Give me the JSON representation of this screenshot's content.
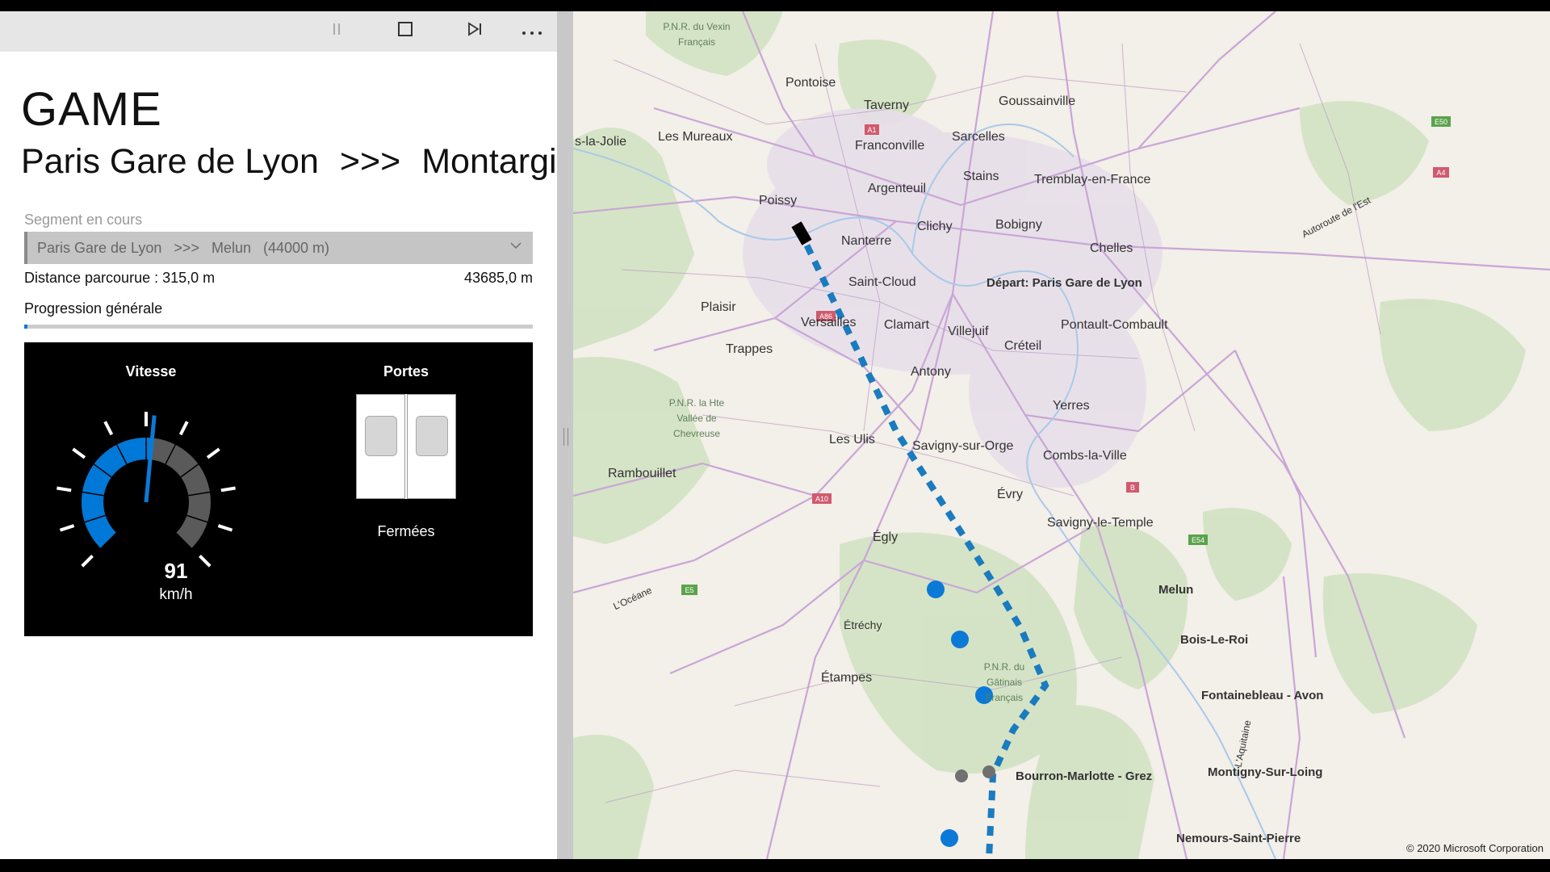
{
  "toolbar": {
    "pause_icon": "pause-icon",
    "stop_icon": "stop-icon",
    "skip_icon": "skip-next-icon",
    "more_icon": "more-icon"
  },
  "header": {
    "title": "GAME",
    "origin": "Paris Gare de Lyon",
    "separator": ">>>",
    "destination": "Montargis"
  },
  "segment": {
    "label": "Segment en cours",
    "selected": "Paris Gare de Lyon   >>>   Melun   (44000 m)"
  },
  "distance": {
    "traveled": "Distance parcourue : 315,0 m",
    "remaining": "43685,0 m"
  },
  "progress": {
    "label": "Progression générale",
    "fraction": 0.007
  },
  "speed": {
    "label": "Vitesse",
    "value": "91",
    "unit": "km/h",
    "gauge_fraction": 0.52
  },
  "doors": {
    "label": "Portes",
    "state": "Fermées"
  },
  "map": {
    "places": [
      "P.N.R. du Vexin Français",
      "Pontoise",
      "Taverny",
      "Goussainville",
      "Les Mureaux",
      "s-la-Jolie",
      "Sarcelles",
      "Franconville",
      "Stains",
      "Tremblay-en-France",
      "Argenteuil",
      "Poissy",
      "Clichy",
      "Bobigny",
      "Nanterre",
      "Chelles",
      "Saint-Cloud",
      "Plaisir",
      "Versailles",
      "Clamart",
      "Villejuif",
      "Créteil",
      "Pontault-Combault",
      "Trappes",
      "Antony",
      "P.N.R. la Hte Vallée de Chevreuse",
      "Yerres",
      "Les Ulis",
      "Savigny-sur-Orge",
      "Combs-la-Ville",
      "Rambouillet",
      "Évry",
      "Savigny-le-Temple",
      "Égly",
      "L'Océane",
      "Étréchy",
      "Étampes",
      "P.N.R. du Gâtinais Français",
      "L'Aquitaine",
      "Autoroute de l'Est"
    ],
    "roads": [
      "A1",
      "A4",
      "E50",
      "A86",
      "A10",
      "E5",
      "E54",
      "B"
    ],
    "stations": [
      {
        "name": "Départ: Paris Gare de Lyon",
        "status": "start"
      },
      {
        "name": "Melun",
        "status": "stop"
      },
      {
        "name": "Bois-Le-Roi",
        "status": "stop"
      },
      {
        "name": "Fontainebleau - Avon",
        "status": "stop"
      },
      {
        "name": "Montigny-Sur-Loing",
        "status": "skip"
      },
      {
        "name": "Bourron-Marlotte - Grez",
        "status": "skip"
      },
      {
        "name": "Nemours-Saint-Pierre",
        "status": "stop"
      }
    ],
    "copyright": "© 2020 Microsoft Corporation",
    "colors": {
      "route": "#1a7bbf",
      "station_stop": "#0a7ad6",
      "station_skip": "#707070",
      "train": "#000000"
    }
  }
}
